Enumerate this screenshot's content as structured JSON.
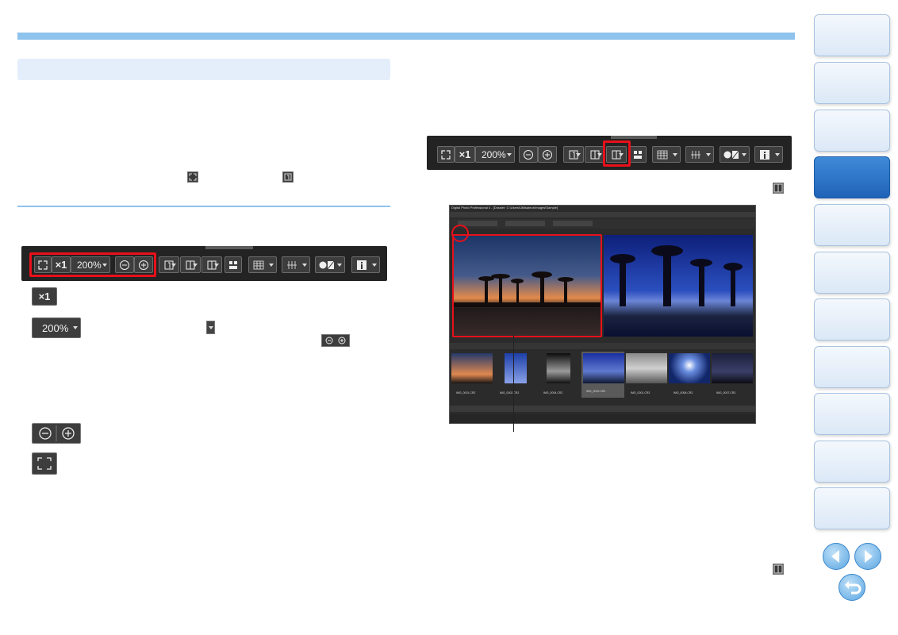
{
  "toolbar": {
    "zoom_x1": "×1",
    "zoom_percent": "200%",
    "zoom_out_symbol": "⊖",
    "zoom_in_symbol": "⊕"
  },
  "legend": {
    "x1_label": "×1",
    "percent_label": "200%"
  },
  "app_screenshot": {
    "title": "Digital Photo Professional 4 - [Dossier: C:\\Users\\Utilisateur\\Images\\Sample]",
    "thumbnails": [
      "IMG_0001.CR2",
      "IMG_0002.CR2",
      "IMG_0004.CR2",
      "IMG_0019.CR2",
      "IMG_0001.CR2",
      "IMG_0006.CR2",
      "IMG_0007.CR2"
    ]
  },
  "colors": {
    "accent_bar": "#8ec3ee",
    "section_bg": "#e3eefa",
    "highlight": "#e8101a",
    "nav_active": "#1f63b8"
  },
  "icons": [
    "fit-window-icon",
    "zoom-x1-icon",
    "zoom-out-icon",
    "zoom-in-icon",
    "single-view-icon",
    "compare-view-icon",
    "multi-view-icon",
    "grid-icon",
    "af-point-icon",
    "highlight-warning-icon",
    "info-icon",
    "pin-icon",
    "prev-page-icon",
    "next-page-icon",
    "return-icon"
  ]
}
